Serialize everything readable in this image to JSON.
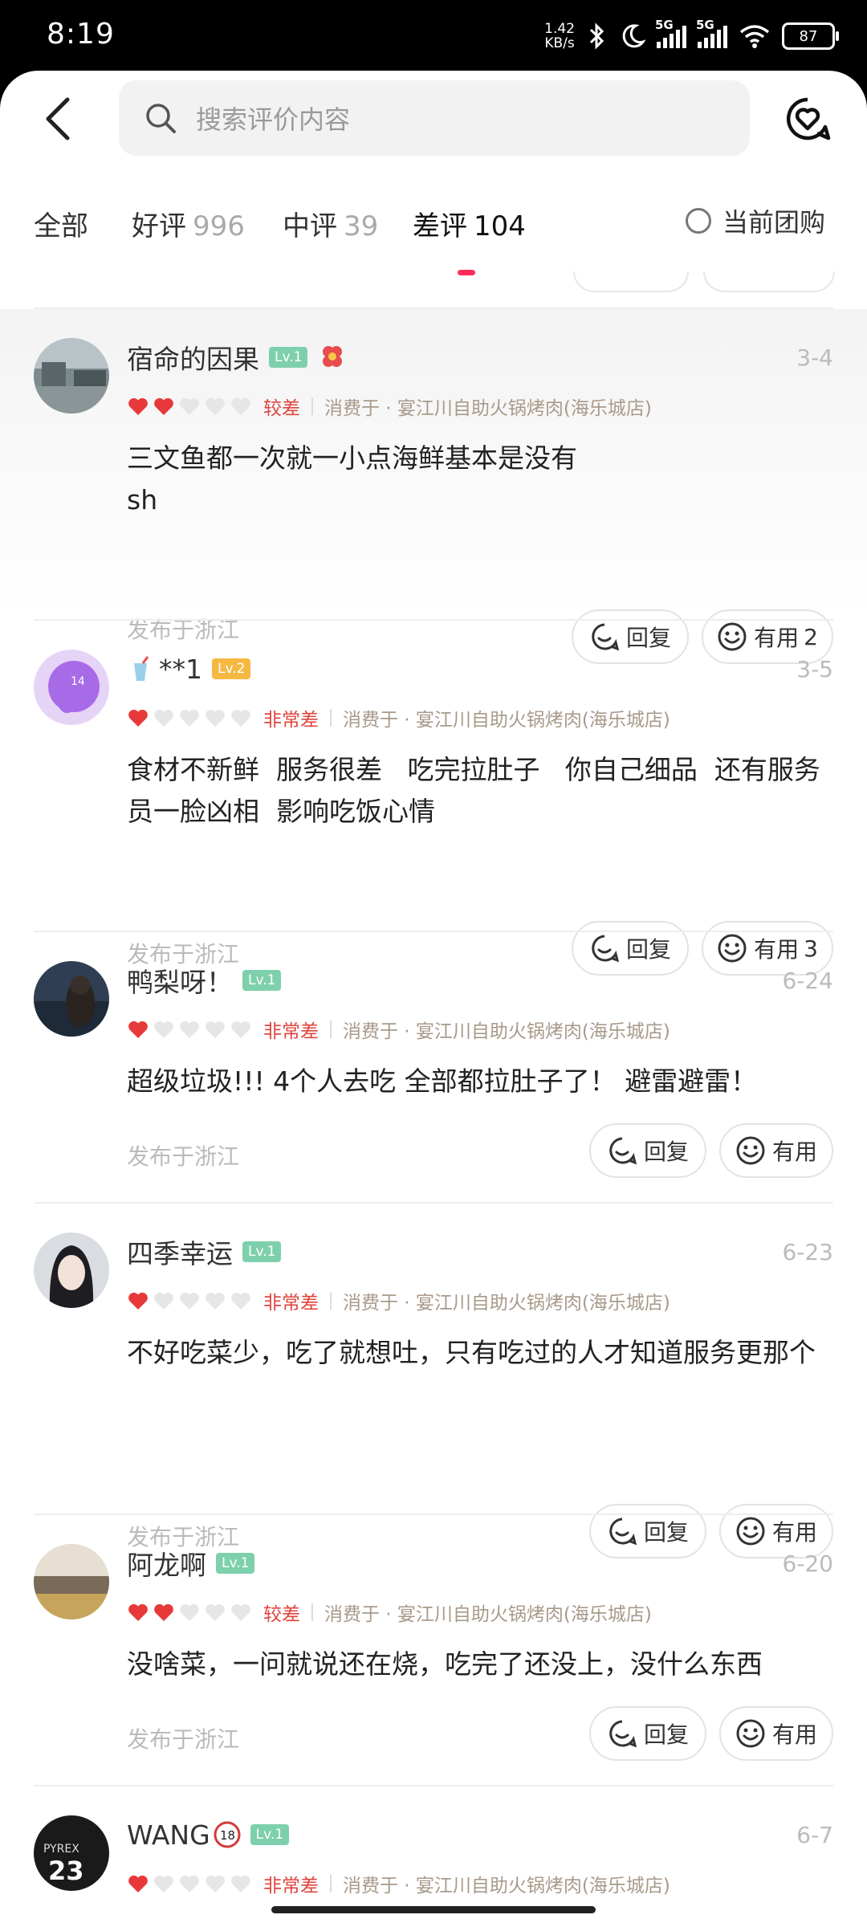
{
  "status": {
    "time": "8:19",
    "speed": "1.42",
    "speed_unit": "KB/s",
    "net1": "5G",
    "net2": "5G",
    "battery": "87"
  },
  "search": {
    "placeholder": "搜索评价内容"
  },
  "tabs": [
    {
      "label": "全部",
      "count": ""
    },
    {
      "label": "好评",
      "count": "996"
    },
    {
      "label": "中评",
      "count": "39"
    },
    {
      "label": "差评",
      "count": "104"
    }
  ],
  "current_group": "当前团购",
  "reply_label": "回复",
  "useful_label": "有用",
  "reviews": [
    {
      "name": "宿命的因果",
      "level": "Lv.1",
      "date": "3-4",
      "hearts": 2,
      "rating_text": "较差",
      "consumed": "消费于 · 宴江川自助火锅烤肉(海乐城店)",
      "text": "三文鱼都一次就一小点海鲜基本是没有\nsh",
      "location": "发布于浙江",
      "useful_count": "2"
    },
    {
      "name": "**1",
      "level": "Lv.2",
      "date": "3-5",
      "hearts": 1,
      "rating_text": "非常差",
      "consumed": "消费于 · 宴江川自助火锅烤肉(海乐城店)",
      "text": "食材不新鲜  服务很差   吃完拉肚子   你自己细品  还有服务员一脸凶相  影响吃饭心情",
      "location": "发布于浙江",
      "useful_count": "3"
    },
    {
      "name": "鸭梨呀！",
      "level": "Lv.1",
      "date": "6-24",
      "hearts": 1,
      "rating_text": "非常差",
      "consumed": "消费于 · 宴江川自助火锅烤肉(海乐城店)",
      "text": "超级垃圾!!! 4个人去吃 全部都拉肚子了！ 避雷避雷！",
      "location": "发布于浙江",
      "useful_count": ""
    },
    {
      "name": "四季幸运",
      "level": "Lv.1",
      "date": "6-23",
      "hearts": 1,
      "rating_text": "非常差",
      "consumed": "消费于 · 宴江川自助火锅烤肉(海乐城店)",
      "text": "不好吃菜少，吃了就想吐，只有吃过的人才知道服务更那个",
      "location": "发布于浙江",
      "useful_count": ""
    },
    {
      "name": "阿龙啊",
      "level": "Lv.1",
      "date": "6-20",
      "hearts": 2,
      "rating_text": "较差",
      "consumed": "消费于 · 宴江川自助火锅烤肉(海乐城店)",
      "text": "没啥菜，一问就说还在烧，吃完了还没上，没什么东西",
      "location": "发布于浙江",
      "useful_count": ""
    },
    {
      "name": "WANG",
      "level": "Lv.1",
      "date": "6-7",
      "hearts": 1,
      "rating_text": "非常差",
      "consumed": "消费于 · 宴江川自助火锅烤肉(海乐城店)",
      "text": "",
      "location": "",
      "useful_count": ""
    }
  ],
  "avatar_text": {
    "r1": "14",
    "r5": "23",
    "r5_top": "PYREX",
    "badge18": "18"
  },
  "colors": {
    "accent": "#ff2d55",
    "heart": "#e8393a",
    "heart_empty": "#e6e6e6",
    "lv": "#7ed0ac",
    "lv_gold": "#f5b943"
  }
}
